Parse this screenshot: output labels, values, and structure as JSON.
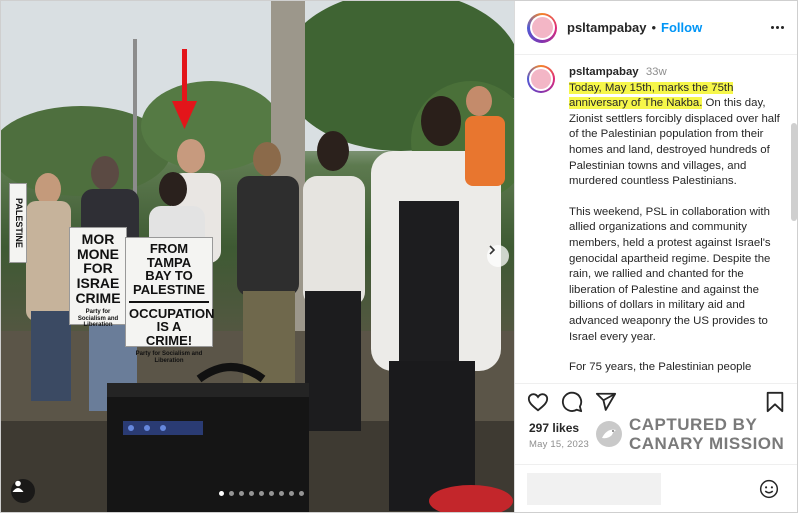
{
  "post": {
    "username": "psltampabay",
    "follow_label": "Follow",
    "header_separator": "•",
    "caption": {
      "username": "psltampabay",
      "timestamp": "33w",
      "highlighted_text": "Today, May 15th, marks the 75th anniversary of The Nakba.",
      "text_after_highlight": " On this day, Zionist settlers forcibly displaced over half of the Palestinian population from their homes and land, destroyed hundreds of Palestinian towns and villages, and murdered countless Palestinians.",
      "paragraph_2": "This weekend, PSL in collaboration with allied organizations and community members, held a protest against Israel's genocidal apartheid regime. Despite the rain, we rallied and chanted for the liberation of Palestine and against the billions of dollars in military aid and advanced weaponry the US provides to Israel every year.",
      "paragraph_3_partial": "For 75 years, the Palestinian people"
    },
    "likes": "297 likes",
    "date": "May 15, 2023",
    "carousel": {
      "total": 9,
      "active_index": 0
    },
    "highlight_color": "#f6f74a"
  },
  "photo_signs": {
    "sign_a": [
      "MOR",
      "MONE",
      "FOR",
      "ISRAE",
      "CRIME"
    ],
    "sign_a_footer": "Party for Socialism and Liberation",
    "sign_b_top": [
      "FROM",
      "TAMPA",
      "BAY TO",
      "PALESTINE"
    ],
    "sign_b_bottom": [
      "OCCUPATION",
      "IS A",
      "CRIME!"
    ],
    "sign_b_footer": "Party for Socialism and Liberation",
    "side_sign": "PALESTINE"
  },
  "watermark": {
    "line1": "CAPTURED BY",
    "line2": "CANARY MISSION"
  },
  "icons": [
    "heart-icon",
    "comment-icon",
    "share-icon",
    "bookmark-icon",
    "emoji-icon",
    "more-options-icon",
    "user-tag-icon",
    "red-arrow-annotation"
  ]
}
